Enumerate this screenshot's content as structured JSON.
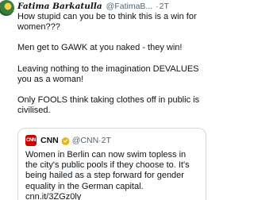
{
  "tweet": {
    "author": {
      "display_name": "Fatima Barkatulla",
      "handle": "@FatimaB...",
      "separator": "·",
      "time": "2T"
    },
    "body": [
      "How stupid can you be to think this is a win for women???",
      "Men get to GAWK at you naked - they win!",
      "Leaving nothing to the imagination DEVALUES you as a woman!",
      "Only FOOLS think taking clothes off in public is civilised."
    ],
    "quote": {
      "logo_text": "CNN",
      "name": "CNN",
      "verified_color": "#e7b416",
      "handle": "@CNN",
      "separator": "·",
      "time": "2T",
      "text": "Women in Berlin can now swim topless in the city's public pools if they choose to. It's being hailed as a step forward for gender equality in the German capital. cnn.it/3ZGz0ly"
    }
  }
}
